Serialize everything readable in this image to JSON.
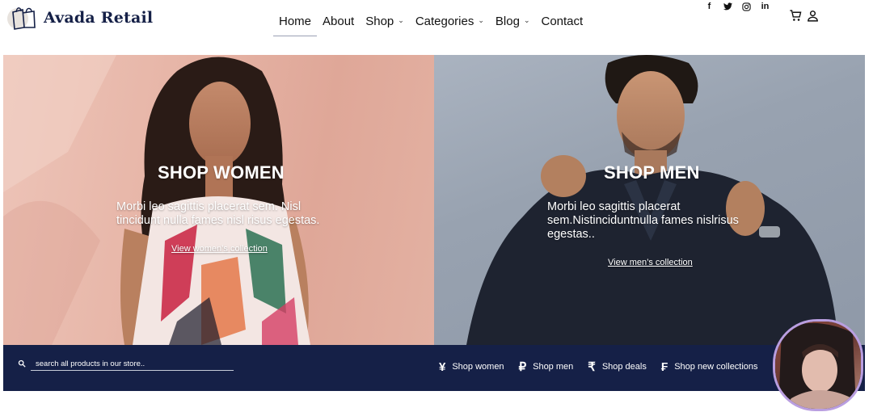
{
  "brand": {
    "name": "Avada Retail",
    "color": "#152047"
  },
  "nav": {
    "items": [
      {
        "label": "Home",
        "has_dropdown": false,
        "active": true
      },
      {
        "label": "About",
        "has_dropdown": false,
        "active": false
      },
      {
        "label": "Shop",
        "has_dropdown": true,
        "active": false
      },
      {
        "label": "Categories",
        "has_dropdown": true,
        "active": false
      },
      {
        "label": "Blog",
        "has_dropdown": true,
        "active": false
      },
      {
        "label": "Contact",
        "has_dropdown": false,
        "active": false
      }
    ],
    "caret_glyph": "⌄"
  },
  "social": {
    "facebook": "f",
    "linkedin": "in",
    "icons": [
      "facebook-icon",
      "twitter-icon",
      "instagram-icon",
      "linkedin-icon"
    ]
  },
  "utility": {
    "icons": [
      "cart-icon",
      "user-icon"
    ]
  },
  "hero": {
    "women": {
      "title": "SHOP WOMEN",
      "text_line1": "Morbi leo sagittis placerat sem. Nisl",
      "text_line2": "tincidunt nulla fames nisl risus egestas.",
      "link": "View women’s collection"
    },
    "men": {
      "title": "SHOP MEN",
      "text_line1": "Morbi leo sagittis placerat",
      "text_line2": "sem.Nistinciduntnulla fames nislrisus",
      "text_line3": "egestas..",
      "link": "View men’s collection"
    }
  },
  "bar": {
    "background": "#152047",
    "search_placeholder": "search all products in our store..",
    "links": [
      {
        "glyph": "¥",
        "label": "Shop women"
      },
      {
        "glyph": "₽",
        "label": "Shop men"
      },
      {
        "glyph": "₹",
        "label": "Shop deals"
      },
      {
        "glyph": "₣",
        "label": "Shop new collections"
      }
    ]
  }
}
